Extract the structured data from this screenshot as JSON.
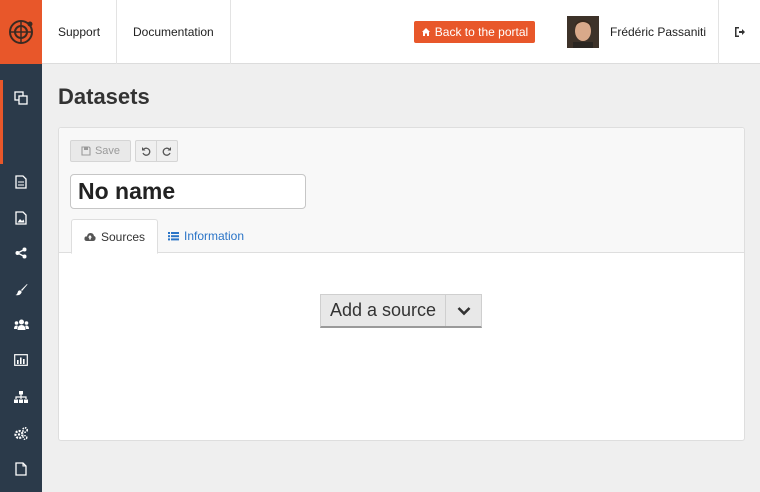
{
  "topbar": {
    "logo_icon": "gear-globe-logo",
    "nav": [
      {
        "label": "Support"
      },
      {
        "label": "Documentation"
      }
    ],
    "portal_button": {
      "label": "Back to the portal",
      "icon": "home-icon",
      "color": "#e8572a"
    },
    "user": {
      "name": "Frédéric Passaniti",
      "avatar": "user-avatar"
    },
    "logout_icon": "sign-out-icon"
  },
  "sidebar": {
    "background": "#2b3a4a",
    "accent": "#e8572a",
    "items": [
      {
        "icon": "copy-icon",
        "active": true
      },
      {
        "icon": "file-icon"
      },
      {
        "icon": "image-file-icon"
      },
      {
        "icon": "share-icon"
      },
      {
        "icon": "brush-icon"
      },
      {
        "icon": "users-icon"
      },
      {
        "icon": "bar-chart-icon"
      },
      {
        "icon": "sitemap-icon"
      },
      {
        "icon": "gears-icon"
      },
      {
        "icon": "file-blank-icon"
      }
    ]
  },
  "main": {
    "title": "Datasets",
    "toolbar": {
      "save_label": "Save",
      "undo_icon": "undo-icon",
      "redo_icon": "redo-icon"
    },
    "name_field": {
      "value": "No name"
    },
    "tabs": [
      {
        "label": "Sources",
        "icon": "cloud-upload-icon",
        "active": true
      },
      {
        "label": "Information",
        "icon": "list-icon",
        "active": false
      }
    ],
    "add_source": {
      "label": "Add a source"
    }
  }
}
